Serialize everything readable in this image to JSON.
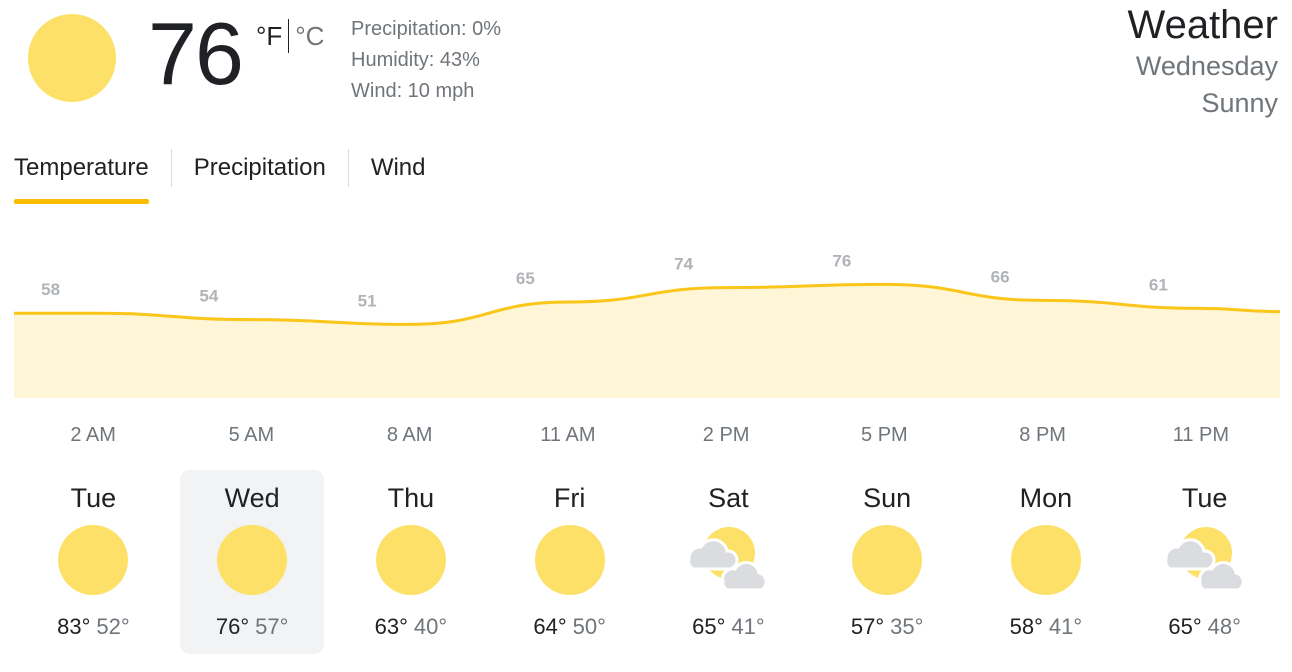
{
  "current": {
    "icon": "sun-icon",
    "temperature": "76",
    "unit_f": "°F",
    "unit_c": "°C",
    "precipitation": "Precipitation: 0%",
    "humidity": "Humidity: 43%",
    "wind": "Wind: 10 mph"
  },
  "header": {
    "title": "Weather",
    "day": "Wednesday",
    "condition": "Sunny"
  },
  "tabs": [
    {
      "label": "Temperature",
      "active": true
    },
    {
      "label": "Precipitation",
      "active": false
    },
    {
      "label": "Wind",
      "active": false
    }
  ],
  "colors": {
    "accent": "#fbbc04",
    "chart_line": "#fbc51a",
    "chart_fill": "#fef6d6",
    "sun": "#fde067"
  },
  "chart_data": {
    "type": "area",
    "x": [
      "2 AM",
      "5 AM",
      "8 AM",
      "11 AM",
      "2 PM",
      "5 PM",
      "8 PM",
      "11 PM"
    ],
    "series": [
      {
        "values": [
          58,
          54,
          51,
          65,
          74,
          76,
          66,
          61
        ]
      }
    ]
  },
  "hours": [
    "2 AM",
    "5 AM",
    "8 AM",
    "11 AM",
    "2 PM",
    "5 PM",
    "8 PM",
    "11 PM"
  ],
  "days": [
    {
      "name": "Tue",
      "icon": "sun-icon",
      "hi": "83°",
      "lo": "52°"
    },
    {
      "name": "Wed",
      "icon": "sun-icon",
      "hi": "76°",
      "lo": "57°",
      "selected": true
    },
    {
      "name": "Thu",
      "icon": "sun-icon",
      "hi": "63°",
      "lo": "40°"
    },
    {
      "name": "Fri",
      "icon": "sun-icon",
      "hi": "64°",
      "lo": "50°"
    },
    {
      "name": "Sat",
      "icon": "partly-cloudy-icon",
      "hi": "65°",
      "lo": "41°"
    },
    {
      "name": "Sun",
      "icon": "sun-icon",
      "hi": "57°",
      "lo": "35°"
    },
    {
      "name": "Mon",
      "icon": "sun-icon",
      "hi": "58°",
      "lo": "41°"
    },
    {
      "name": "Tue",
      "icon": "partly-cloudy-icon",
      "hi": "65°",
      "lo": "48°"
    }
  ]
}
